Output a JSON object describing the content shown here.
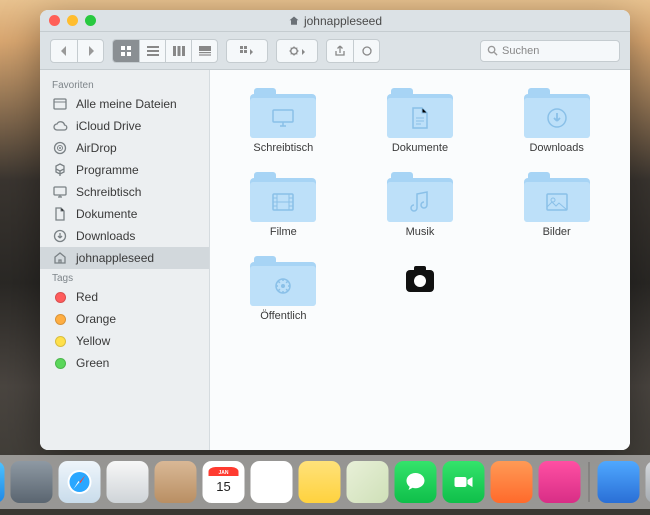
{
  "window": {
    "title": "johnappleseed"
  },
  "search": {
    "placeholder": "Suchen"
  },
  "sidebar": {
    "sections": [
      {
        "header": "Favoriten",
        "items": [
          {
            "icon": "all-files-icon",
            "label": "Alle meine Dateien",
            "selected": false
          },
          {
            "icon": "cloud-icon",
            "label": "iCloud Drive",
            "selected": false
          },
          {
            "icon": "airdrop-icon",
            "label": "AirDrop",
            "selected": false
          },
          {
            "icon": "apps-icon",
            "label": "Programme",
            "selected": false
          },
          {
            "icon": "desktop-icon",
            "label": "Schreibtisch",
            "selected": false
          },
          {
            "icon": "document-icon",
            "label": "Dokumente",
            "selected": false
          },
          {
            "icon": "downloads-icon",
            "label": "Downloads",
            "selected": false
          },
          {
            "icon": "home-icon",
            "label": "johnappleseed",
            "selected": true
          }
        ]
      },
      {
        "header": "Tags",
        "items": [
          {
            "icon": "tag-dot",
            "color": "#ff5c5c",
            "label": "Red"
          },
          {
            "icon": "tag-dot",
            "color": "#ffae42",
            "label": "Orange"
          },
          {
            "icon": "tag-dot",
            "color": "#ffe04b",
            "label": "Yellow"
          },
          {
            "icon": "tag-dot",
            "color": "#5bd75b",
            "label": "Green"
          }
        ]
      }
    ]
  },
  "folders": [
    {
      "label": "Schreibtisch",
      "glyph": "desktop"
    },
    {
      "label": "Dokumente",
      "glyph": "document"
    },
    {
      "label": "Downloads",
      "glyph": "download"
    },
    {
      "label": "Filme",
      "glyph": "movie"
    },
    {
      "label": "Musik",
      "glyph": "music"
    },
    {
      "label": "Bilder",
      "glyph": "picture"
    },
    {
      "label": "Öffentlich",
      "glyph": "public"
    }
  ],
  "extra_item": {
    "type": "camera-icon"
  },
  "dock": [
    {
      "name": "finder",
      "bg": "linear-gradient(180deg,#4fc3ff,#1e88e5)"
    },
    {
      "name": "launchpad",
      "bg": "linear-gradient(180deg,#8e99a3,#5a6570)"
    },
    {
      "name": "safari",
      "bg": "linear-gradient(180deg,#eef5fb,#c9dceb)"
    },
    {
      "name": "mail",
      "bg": "linear-gradient(180deg,#f7f7f7,#cfd4d8)"
    },
    {
      "name": "contacts",
      "bg": "linear-gradient(180deg,#d9b896,#b98f63)"
    },
    {
      "name": "calendar",
      "bg": "#ffffff"
    },
    {
      "name": "reminders",
      "bg": "#ffffff"
    },
    {
      "name": "notes",
      "bg": "linear-gradient(180deg,#ffe27a,#ffd23e)"
    },
    {
      "name": "maps",
      "bg": "linear-gradient(135deg,#e8f0d8,#cfe0b8)"
    },
    {
      "name": "messages",
      "bg": "linear-gradient(180deg,#34e36b,#0fbf4a)"
    },
    {
      "name": "facetime",
      "bg": "linear-gradient(180deg,#34e36b,#0fbf4a)"
    },
    {
      "name": "photobooth",
      "bg": "linear-gradient(180deg,#ff9a56,#ff6a2b)"
    },
    {
      "name": "itunes",
      "bg": "linear-gradient(180deg,#ff4fa3,#d82e86)"
    },
    {
      "name": "iphoto",
      "bg": "linear-gradient(180deg,#4fa8ff,#2a6fd6)"
    },
    {
      "name": "preferences",
      "bg": "linear-gradient(180deg,#d5d9dd,#a5abb1)"
    }
  ],
  "calendar": {
    "month": "JAN",
    "day": "15"
  }
}
